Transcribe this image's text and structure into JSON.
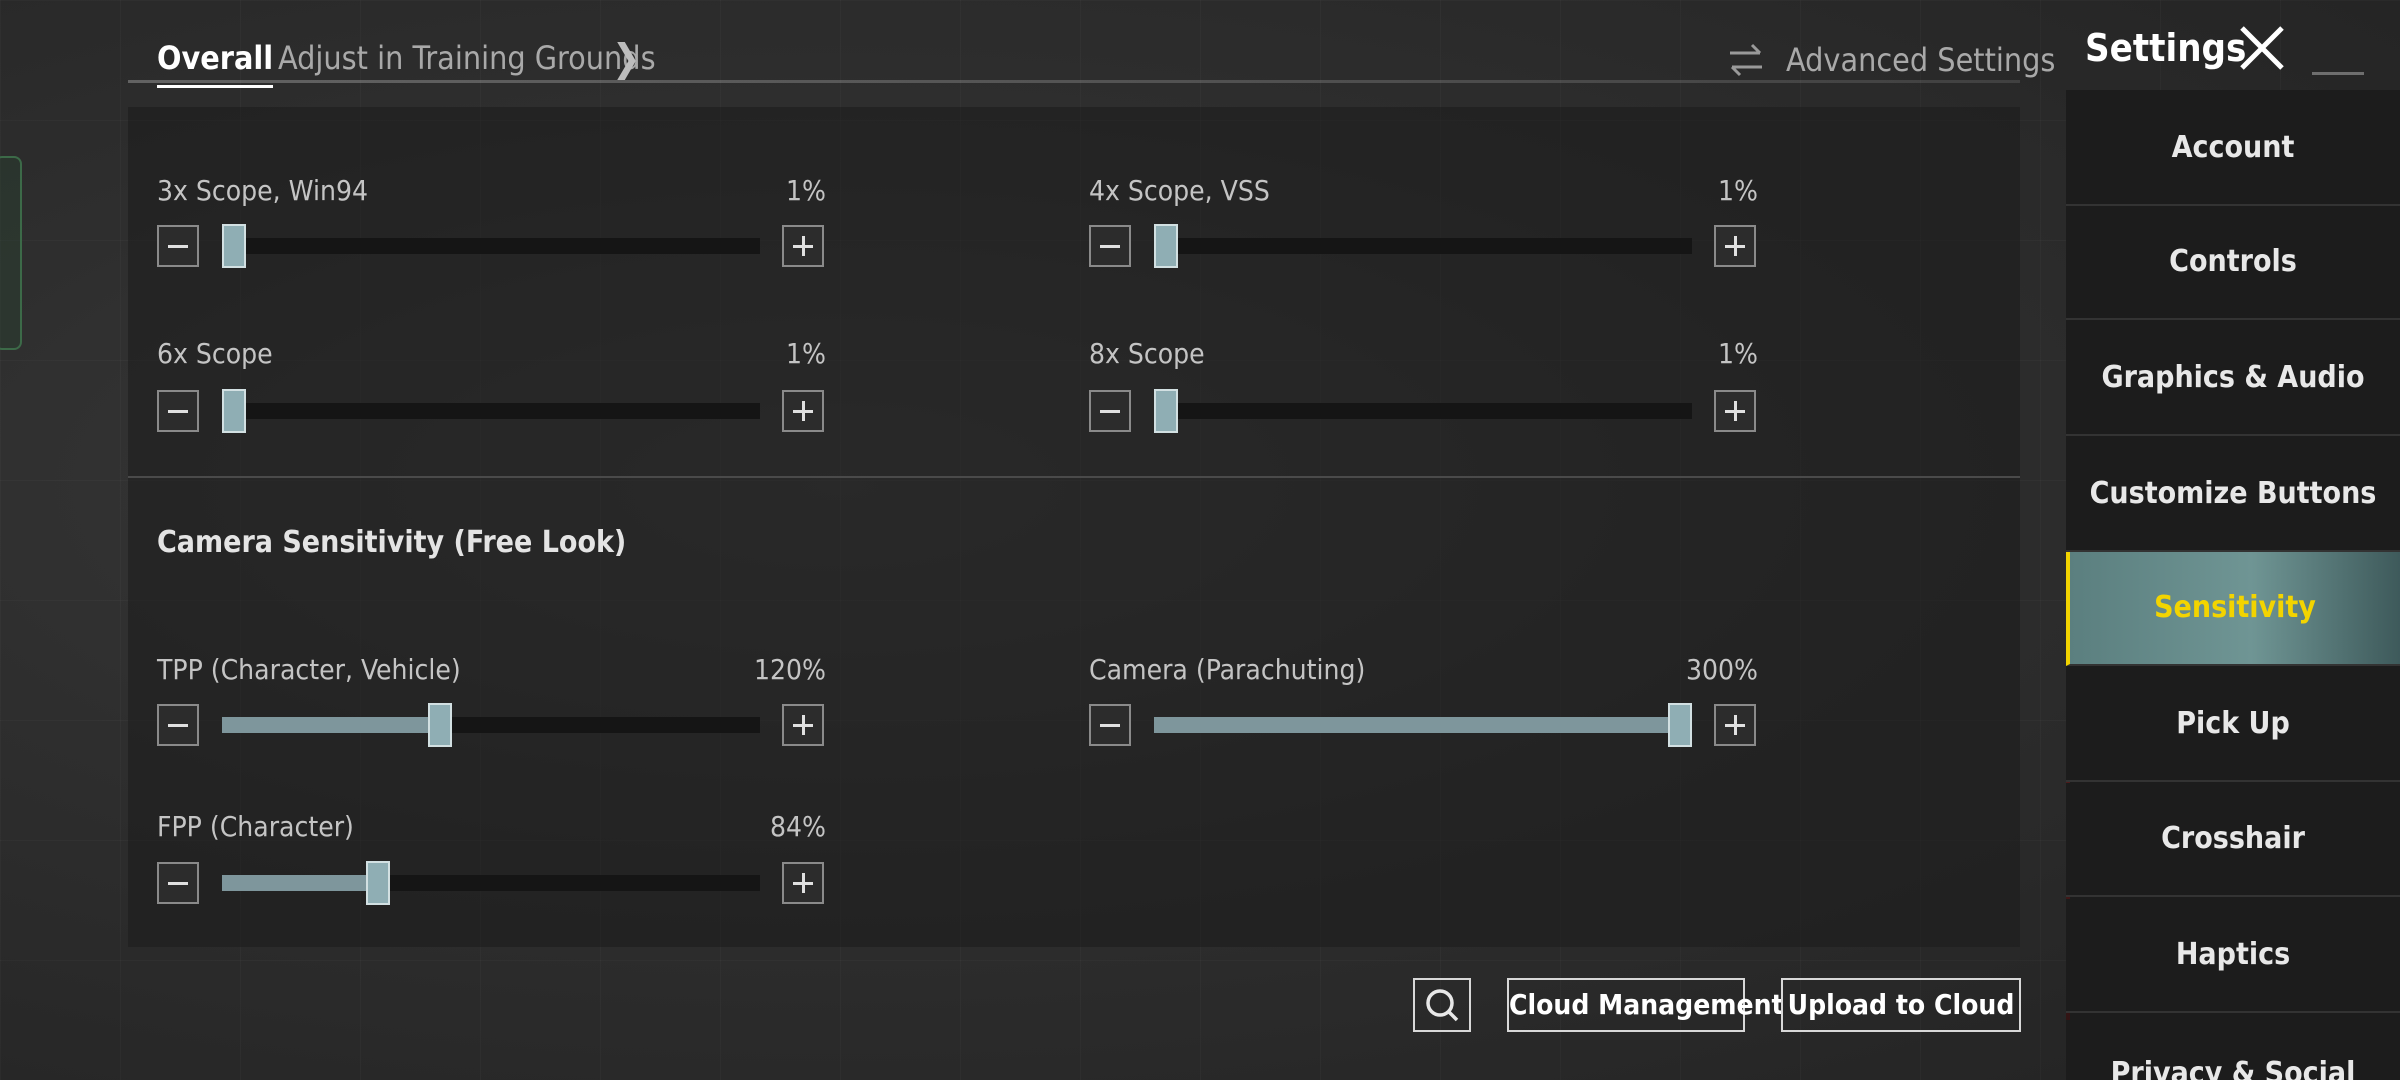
{
  "tabs": {
    "overall": "Overall",
    "training": "Adjust in Training Grounds"
  },
  "advanced_settings": "Advanced Settings",
  "settings_title": "Settings",
  "scopes": [
    {
      "label": "3x Scope, Win94",
      "value": "1%",
      "level": 0.01
    },
    {
      "label": "4x Scope, VSS",
      "value": "1%",
      "level": 0.01
    },
    {
      "label": "6x Scope",
      "value": "1%",
      "level": 0.01
    },
    {
      "label": "8x Scope",
      "value": "1%",
      "level": 0.01
    }
  ],
  "camera_section": {
    "title": "Camera Sensitivity (Free Look)",
    "sliders": [
      {
        "label": "TPP (Character, Vehicle)",
        "value": "120%",
        "level": 0.4
      },
      {
        "label": "Camera (Parachuting)",
        "value": "300%",
        "level": 1.0
      },
      {
        "label": "FPP (Character)",
        "value": "84%",
        "level": 0.28
      }
    ]
  },
  "bottom_buttons": {
    "cloud_management": "Cloud Management",
    "upload_to_cloud": "Upload to Cloud"
  },
  "sidebar": {
    "items": [
      {
        "label": "Account"
      },
      {
        "label": "Controls"
      },
      {
        "label": "Graphics & Audio"
      },
      {
        "label": "Customize Buttons"
      },
      {
        "label": "Sensitivity",
        "active": true
      },
      {
        "label": "Pick Up"
      },
      {
        "label": "Crosshair"
      },
      {
        "label": "Haptics"
      },
      {
        "label": "Privacy & Social"
      }
    ]
  },
  "colors": {
    "accent_active_text": "#f3d400",
    "slider_thumb": "#8faeb4",
    "slider_fill": "#7e969c"
  }
}
